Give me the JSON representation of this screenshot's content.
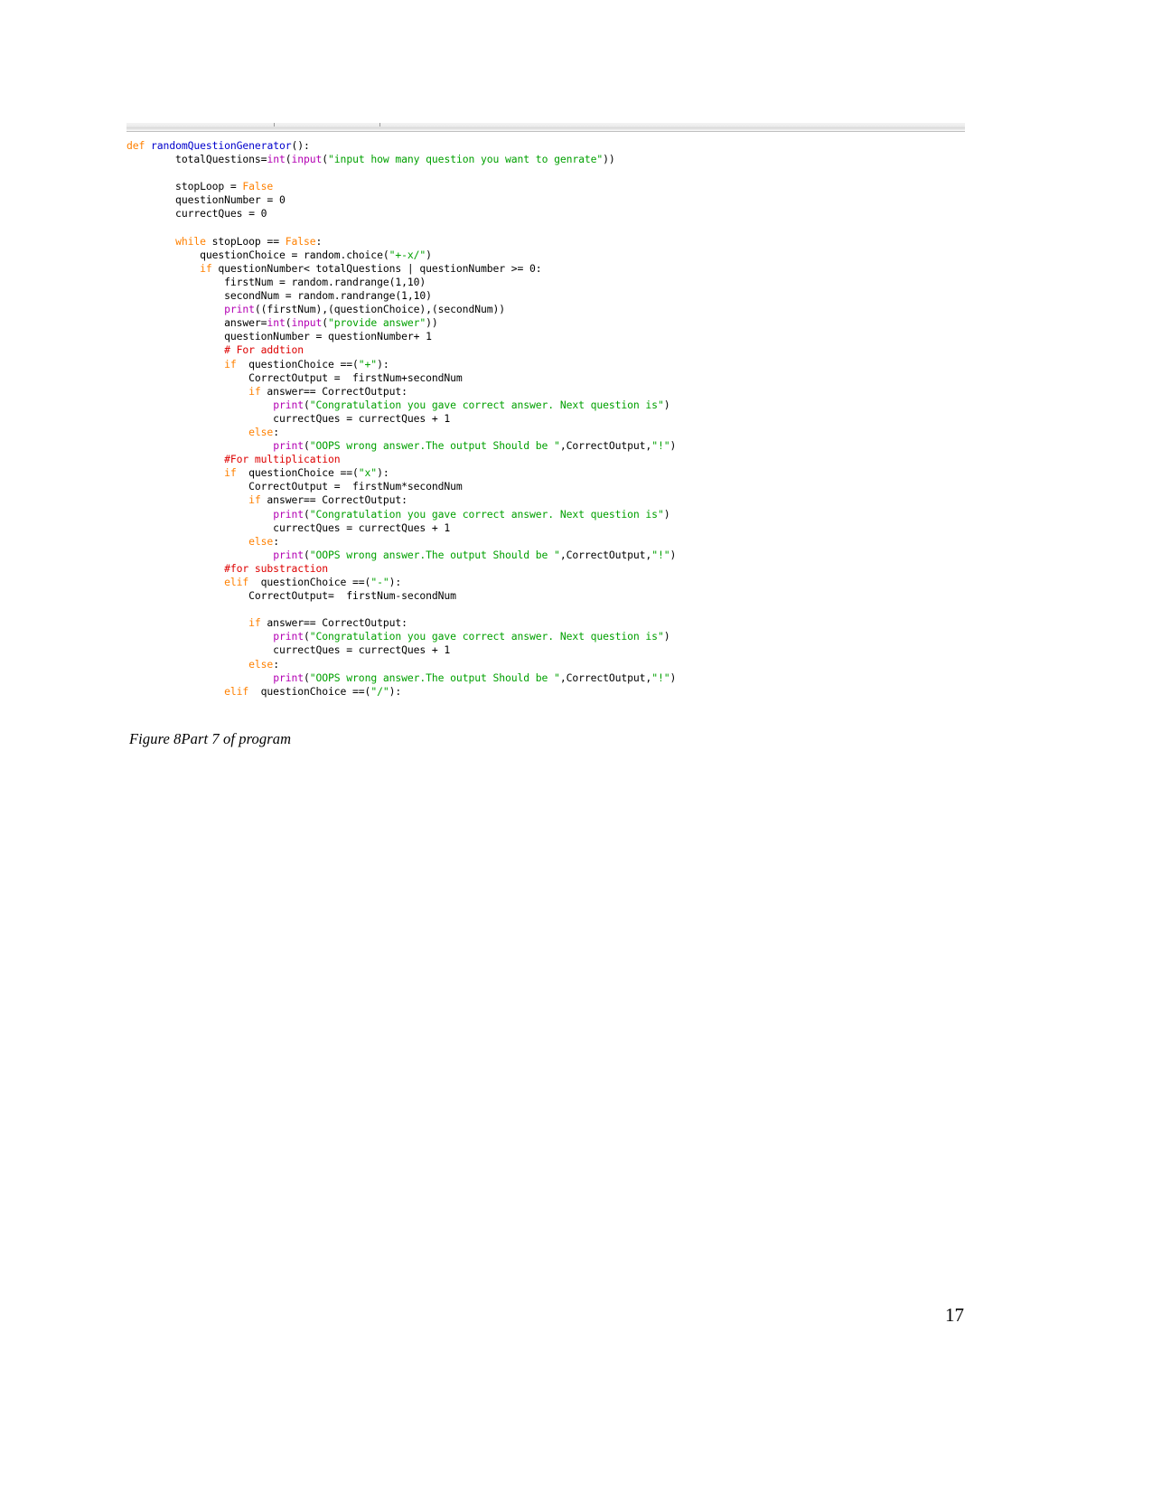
{
  "document": {
    "page_number": "17",
    "caption": "Figure 8Part 7 of program"
  },
  "code_figure": {
    "language": "python",
    "colors": {
      "keyword": "#ff8000",
      "function_name": "#0000cc",
      "builtin": "#b300b3",
      "string": "#00a000",
      "comment": "#dd0000",
      "plain": "#000000",
      "background": "#ffffff"
    },
    "lines": [
      "def randomQuestionGenerator():",
      "        totalQuestions=int(input(\"input how many question you want to genrate\"))",
      "",
      "        stopLoop = False",
      "        questionNumber = 0",
      "        currectQues = 0",
      "",
      "        while stopLoop == False:",
      "            questionChoice = random.choice(\"+-x/\")",
      "            if questionNumber< totalQuestions | questionNumber >= 0:",
      "                firstNum = random.randrange(1,10)",
      "                secondNum = random.randrange(1,10)",
      "                print((firstNum),(questionChoice),(secondNum))",
      "                answer=int(input(\"provide answer\"))",
      "                questionNumber = questionNumber+ 1",
      "                # For addtion",
      "                if  questionChoice ==(\"+\"):",
      "                    CorrectOutput =  firstNum+secondNum",
      "                    if answer== CorrectOutput:",
      "                        print(\"Congratulation you gave correct answer. Next question is\")",
      "                        currectQues = currectQues + 1",
      "                    else:",
      "                        print(\"OOPS wrong answer.The output Should be \",CorrectOutput,\"!\")",
      "                #For multiplication",
      "                if  questionChoice ==(\"x\"):",
      "                    CorrectOutput =  firstNum*secondNum",
      "                    if answer== CorrectOutput:",
      "                        print(\"Congratulation you gave correct answer. Next question is\")",
      "                        currectQues = currectQues + 1",
      "                    else:",
      "                        print(\"OOPS wrong answer.The output Should be \",CorrectOutput,\"!\")",
      "                #for substraction",
      "                elif  questionChoice ==(\"-\"):",
      "                    CorrectOutput=  firstNum-secondNum",
      "",
      "                    if answer== CorrectOutput:",
      "                        print(\"Congratulation you gave correct answer. Next question is\")",
      "                        currectQues = currectQues + 1",
      "                    else:",
      "                        print(\"OOPS wrong answer.The output Should be \",CorrectOutput,\"!\")",
      "                elif  questionChoice ==(\"/\"):"
    ]
  }
}
